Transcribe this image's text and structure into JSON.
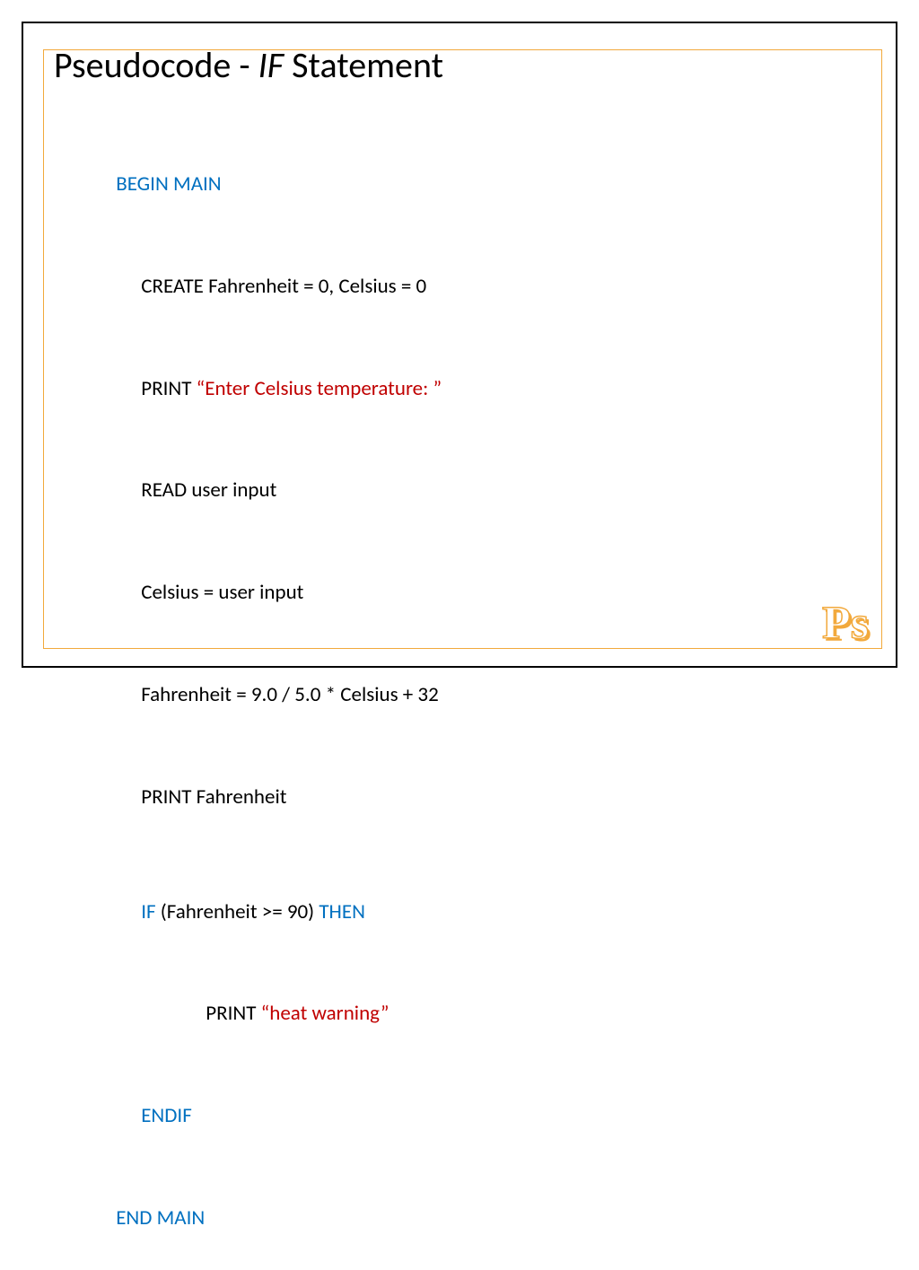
{
  "title": {
    "prefix": "Pseudocode - ",
    "italic": "IF",
    "suffix": " Statement"
  },
  "code": {
    "begin_main": "BEGIN MAIN",
    "create_line": "CREATE Fahrenheit = 0, Celsius = 0",
    "print_keyword": "PRINT ",
    "print_prompt": "“Enter Celsius temperature: ”",
    "read_line": "READ user input",
    "celsius_assign": "Celsius = user input",
    "fahrenheit_calc": "Fahrenheit = 9.0 / 5.0 * Celsius + 32",
    "print_fahrenheit": "PRINT Fahrenheit",
    "if_keyword": "IF ",
    "if_condition": "(Fahrenheit >= 90) ",
    "then_keyword": "THEN",
    "print_warning_prefix": "PRINT ",
    "print_warning": "“heat warning”",
    "endif": "ENDIF",
    "end_main": "END MAIN"
  },
  "logo": "Ps"
}
